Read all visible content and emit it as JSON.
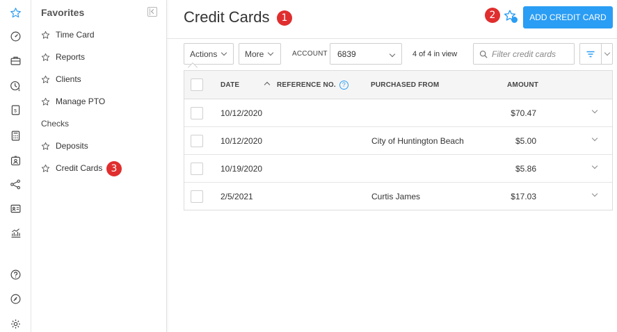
{
  "sidebar_rail": {
    "icons": [
      "star-icon",
      "dashboard-icon",
      "briefcase-icon",
      "clock-dollar-icon",
      "dollar-document-icon",
      "calculator-icon",
      "badge-icon",
      "share-icon",
      "contact-card-icon",
      "chart-icon",
      "help-icon",
      "gauge-icon",
      "settings-icon"
    ]
  },
  "favorites": {
    "title": "Favorites",
    "items": [
      {
        "label": "Time Card"
      },
      {
        "label": "Reports"
      },
      {
        "label": "Clients"
      },
      {
        "label": "Manage PTO"
      }
    ],
    "group_label": "Checks",
    "group_items": [
      {
        "label": "Deposits"
      },
      {
        "label": "Credit Cards"
      }
    ]
  },
  "header": {
    "title": "Credit Cards",
    "add_button": "ADD CREDIT CARD"
  },
  "badges": [
    "1",
    "2",
    "3"
  ],
  "toolbar": {
    "actions_label": "Actions",
    "more_label": "More",
    "account_label": "ACCOUNT",
    "account_value": "6839",
    "view_count": "4 of 4 in view",
    "filter_placeholder": "Filter credit cards"
  },
  "table": {
    "columns": [
      "DATE",
      "REFERENCE NO.",
      "PURCHASED FROM",
      "AMOUNT"
    ],
    "help_glyph": "?",
    "rows": [
      {
        "date": "10/12/2020",
        "reference": "",
        "purchased_from": "",
        "amount": "$70.47"
      },
      {
        "date": "10/12/2020",
        "reference": "",
        "purchased_from": "City of Huntington Beach",
        "amount": "$5.00"
      },
      {
        "date": "10/19/2020",
        "reference": "",
        "purchased_from": "",
        "amount": "$5.86"
      },
      {
        "date": "2/5/2021",
        "reference": "",
        "purchased_from": "Curtis James",
        "amount": "$17.03"
      }
    ]
  },
  "colors": {
    "accent": "#2a9df4",
    "badge": "#e02e2e"
  }
}
